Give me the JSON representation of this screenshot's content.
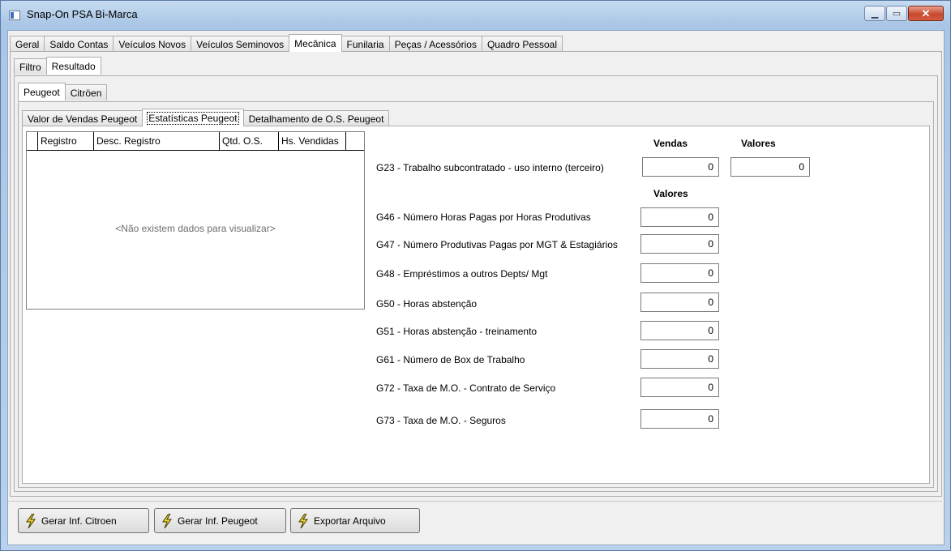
{
  "window": {
    "title": "Snap-On PSA Bi-Marca",
    "close_glyph": "✕",
    "minimize_glyph": "▁",
    "maximize_glyph": "▭"
  },
  "main_tabs": [
    "Geral",
    "Saldo Contas",
    "Veículos Novos",
    "Veículos Seminovos",
    "Mecânica",
    "Funilaria",
    "Peças / Acessórios",
    "Quadro Pessoal"
  ],
  "sub_tabs": [
    "Filtro",
    "Resultado"
  ],
  "brand_tabs": [
    "Peugeot",
    "Citröen"
  ],
  "report_tabs": [
    "Valor de Vendas Peugeot",
    "Estatísticas Peugeot",
    "Detalhamento de O.S. Peugeot"
  ],
  "grid": {
    "columns": [
      "Registro",
      "Desc. Registro",
      "Qtd. O.S.",
      "Hs. Vendidas"
    ],
    "empty_text": "<Não existem dados para visualizar>"
  },
  "stats": {
    "header_vendas": "Vendas",
    "header_valores": "Valores",
    "header_valores2": "Valores",
    "g23_label": "G23 - Trabalho subcontratado - uso interno (terceiro)",
    "g23_vendas": "0",
    "g23_valores": "0",
    "rows": [
      {
        "label": "G46 - Número Horas Pagas por Horas Produtivas",
        "value": "0"
      },
      {
        "label": "G47 - Número Produtivas Pagas por MGT & Estagiários",
        "value": "0"
      },
      {
        "label": "G48 - Empréstimos a outros Depts/ Mgt",
        "value": "0"
      },
      {
        "label": "G50 - Horas abstenção",
        "value": "0"
      },
      {
        "label": "G51 - Horas abstenção - treinamento",
        "value": "0"
      },
      {
        "label": "G61 - Número de Box de Trabalho",
        "value": "0"
      },
      {
        "label": "G72 - Taxa de M.O. - Contrato de Serviço",
        "value": "0"
      },
      {
        "label": "G73 - Taxa de M.O. - Seguros",
        "value": "0"
      }
    ]
  },
  "buttons": {
    "gerar_citroen": "Gerar Inf. Citroen",
    "gerar_peugeot": "Gerar Inf. Peugeot",
    "exportar": "Exportar Arquivo"
  },
  "colors": {
    "bolt_fill": "#f5d22a",
    "bolt_stroke": "#3a3a00"
  }
}
